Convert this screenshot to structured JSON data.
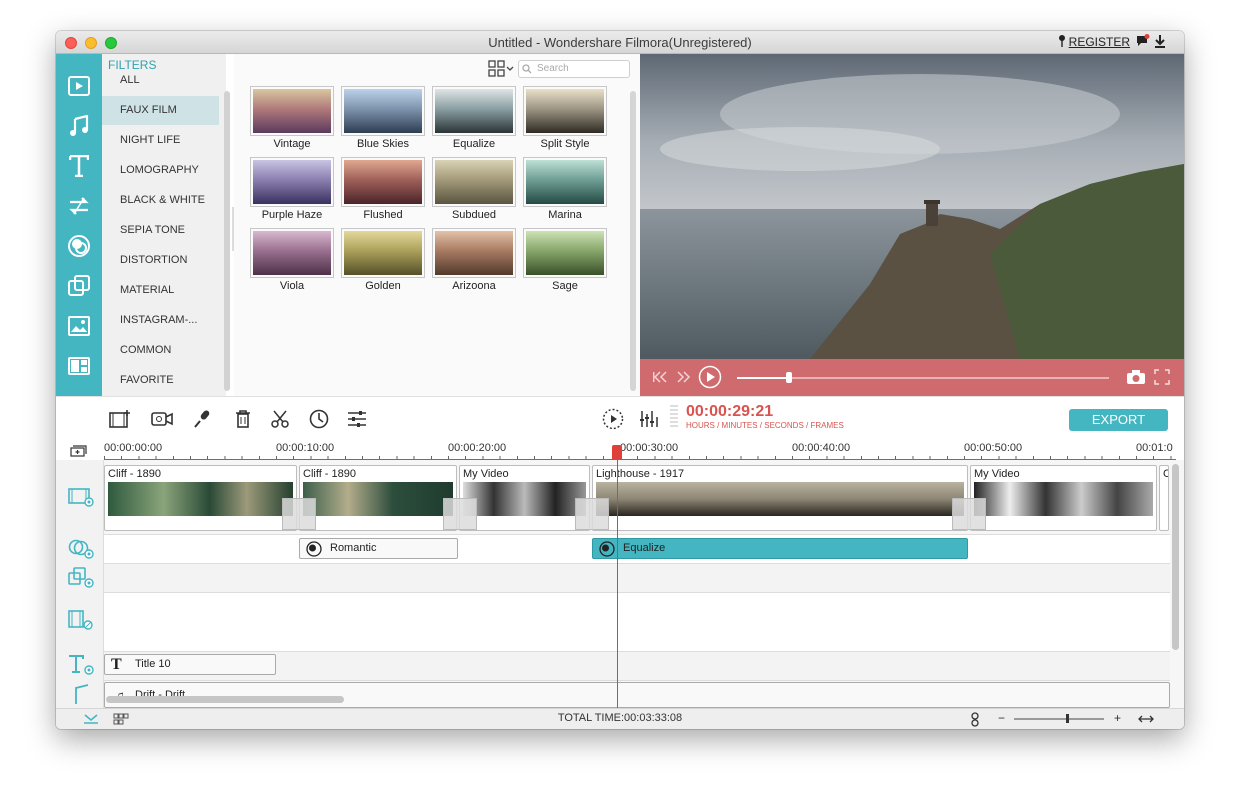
{
  "window": {
    "title": "Untitled - Wondershare Filmora(Unregistered)",
    "register": "REGISTER"
  },
  "sidebar": {
    "icons": [
      "media-icon",
      "music-icon",
      "text-icon",
      "transition-icon",
      "filter-icon",
      "overlay-icon",
      "element-icon",
      "split-screen-icon"
    ]
  },
  "filters": {
    "heading": "FILTERS",
    "categories": [
      "ALL",
      "FAUX FILM",
      "NIGHT LIFE",
      "LOMOGRAPHY",
      "BLACK & WHITE",
      "SEPIA TONE",
      "DISTORTION",
      "MATERIAL",
      "INSTAGRAM-...",
      "COMMON",
      "FAVORITE"
    ],
    "selected": "FAUX FILM",
    "search_placeholder": "Search",
    "items": [
      "Vintage",
      "Blue Skies",
      "Equalize",
      "Split Style",
      "Purple Haze",
      "Flushed",
      "Subdued",
      "Marina",
      "Viola",
      "Golden",
      "Arizoona",
      "Sage"
    ]
  },
  "toolbar": {
    "timecode": "00:00:29:21",
    "timecode_units": "HOURS / MINUTES / SECONDS / FRAMES",
    "export": "EXPORT"
  },
  "ruler": {
    "labels": [
      "00:00:00:00",
      "00:00:10:00",
      "00:00:20:00",
      "00:00:30:00",
      "00:00:40:00",
      "00:00:50:00",
      "00:01:0"
    ]
  },
  "timeline": {
    "video_clips": [
      "Cliff - 1890",
      "Cliff - 1890",
      "My Video",
      "Lighthouse - 1917",
      "My Video",
      "C"
    ],
    "filter_clips": [
      "Romantic",
      "Equalize"
    ],
    "title_clip": "Title 10",
    "audio_clip": "Drift - Drift"
  },
  "status": {
    "total_time": "TOTAL TIME:00:03:33:08",
    "zoom_minus": "−",
    "zoom_plus": "+"
  },
  "colors": {
    "accent": "#43b6c2",
    "preview_bar": "#cf6b6e",
    "playhead": "#e0403a"
  }
}
